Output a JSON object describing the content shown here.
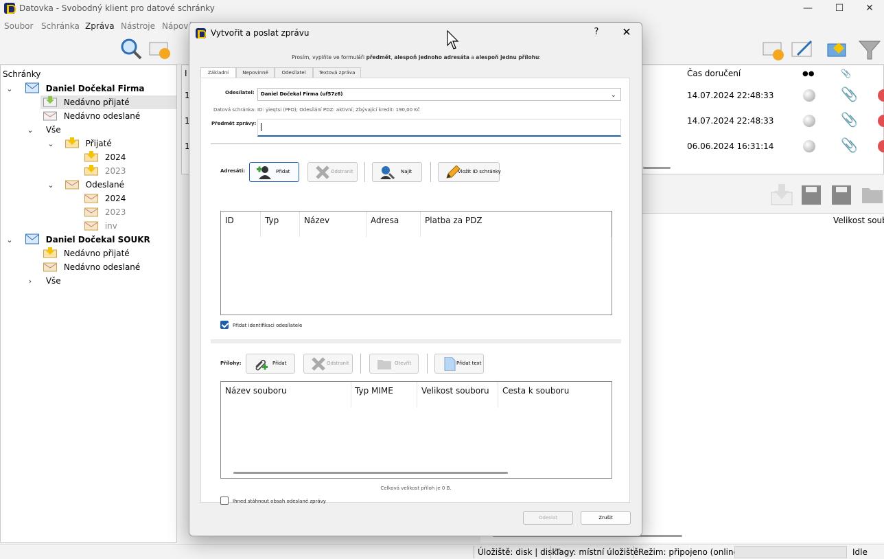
{
  "window": {
    "title": "Datovka - Svobodný klient pro datové schránky",
    "minimize": "—",
    "maximize": "☐",
    "close": "✕"
  },
  "menu": [
    "Soubor",
    "Schránka",
    "Zpráva",
    "Nástroje",
    "Nápově"
  ],
  "sidebar": {
    "header": "Schránky",
    "accounts": [
      {
        "name": "Daniel Dočekal Firma",
        "recent_received": "Nedávno přijaté",
        "recent_sent": "Nedávno odeslané",
        "all": "Vše",
        "received": "Přijaté",
        "received_years": [
          "2024",
          "2023"
        ],
        "sent": "Odeslané",
        "sent_years": [
          "2024",
          "2023",
          "inv"
        ]
      },
      {
        "name": "Daniel Dočekal SOUKR",
        "recent_received": "Nedávno přijaté",
        "recent_sent": "Nedávno odeslané",
        "all": "Vše"
      }
    ]
  },
  "message_list": {
    "col_id": "I",
    "col_delivery": "Čas doručení",
    "rows": [
      {
        "id": "1",
        "delivery": "14.07.2024 22:48:33"
      },
      {
        "id": "1",
        "delivery": "14.07.2024 22:48:33"
      },
      {
        "id": "1",
        "delivery": "06.06.2024 16:31:14"
      }
    ]
  },
  "attachments_panel": {
    "col_size": "Velikost soubo"
  },
  "status": {
    "storage": "Úložiště: disk | disk",
    "tags": "Tagy: místní úložiště",
    "mode": "Režim: připojeno (online)",
    "state": "Idle"
  },
  "dialog": {
    "title": "Vytvořit a poslat zprávu",
    "help": "?",
    "close": "✕",
    "note_prefix": "Prosím, vyplňte ve formuláři ",
    "note_subject": "předmět",
    "note_mid": ", ",
    "note_recipient": "alespoň jednoho adresáta",
    "note_and": " a ",
    "note_attachment": "alespoň jednu přílohu",
    "note_suffix": ":",
    "tabs": [
      "Základní",
      "Nepovinné",
      "Odesílatel",
      "Textová zpráva"
    ],
    "sender_label": "Odesílatel:",
    "sender_value": "Daniel Dočekal Firma (uf57z6)",
    "databox_label": "Datová schránka:",
    "databox_value": "ID: yieqtsi (PFO); Odesílání PDZ: aktivní; Zbývající kredit: 190,00 Kč",
    "subject_label": "Předmět zprávy:",
    "subject_value": "",
    "recipients_label": "Adresáti:",
    "recipients_buttons": {
      "add": "Přidat",
      "remove": "Odstranit",
      "find": "Najít",
      "insert_id": "Vložit ID schránky"
    },
    "recipients_columns": [
      "ID",
      "Typ",
      "Název",
      "Adresa",
      "Platba za PDZ"
    ],
    "add_sender_identification": "Přidat identifikaci odesílatele",
    "attachments_label": "Přílohy:",
    "attachments_buttons": {
      "add": "Přidat",
      "remove": "Odstranit",
      "open": "Otevřít",
      "add_text": "Přidat text"
    },
    "attachments_columns": [
      "Název souboru",
      "Typ MIME",
      "Velikost souboru",
      "Cesta k souboru"
    ],
    "total_size": "Celková velikost příloh je 0 B.",
    "download_sent": "Ihned stáhnout obsah odeslané zprávy",
    "send": "Odeslat",
    "cancel": "Zrušit"
  },
  "colors": {
    "accent": "#1f5fb0",
    "logo_bg": "#1b2a6b",
    "logo_fg": "#f5c400"
  }
}
